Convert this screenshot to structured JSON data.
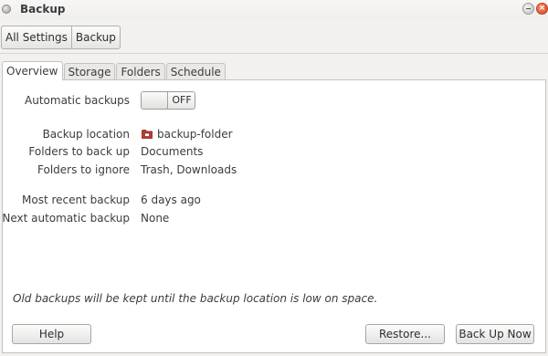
{
  "window": {
    "title": "Backup"
  },
  "breadcrumb": {
    "items": [
      "All Settings",
      "Backup"
    ]
  },
  "tabs": [
    {
      "label": "Overview",
      "active": true
    },
    {
      "label": "Storage",
      "active": false
    },
    {
      "label": "Folders",
      "active": false
    },
    {
      "label": "Schedule",
      "active": false
    }
  ],
  "overview": {
    "automatic_backups_label": "Automatic backups",
    "automatic_backups_state": "OFF",
    "backup_location_label": "Backup location",
    "backup_location_value": "backup-folder",
    "folders_to_back_up_label": "Folders to back up",
    "folders_to_back_up_value": "Documents",
    "folders_to_ignore_label": "Folders to ignore",
    "folders_to_ignore_value": "Trash, Downloads",
    "most_recent_backup_label": "Most recent backup",
    "most_recent_backup_value": "6 days ago",
    "next_automatic_backup_label": "Next automatic backup",
    "next_automatic_backup_value": "None",
    "note": "Old backups will be kept until the backup location is low on space."
  },
  "buttons": {
    "help": "Help",
    "restore": "Restore...",
    "back_up_now": "Back Up Now"
  },
  "icons": {
    "window_menu": "window-menu-dot-icon",
    "minimize": "minimize-icon",
    "close": "close-icon",
    "folder": "folder-icon"
  },
  "colors": {
    "close_button": "#d7461e",
    "folder_icon": "#c0392b"
  }
}
